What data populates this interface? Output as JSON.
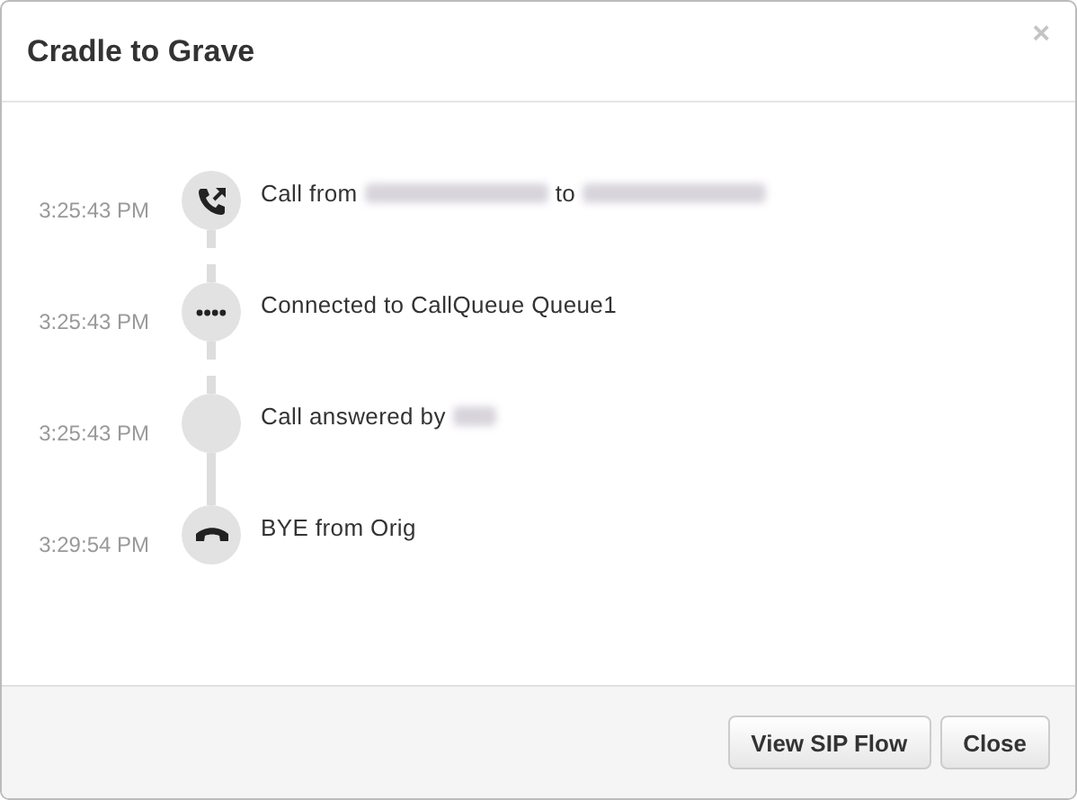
{
  "dialog": {
    "title": "Cradle to Grave",
    "close": "×"
  },
  "events": [
    {
      "time": "3:25:43 PM",
      "kind": "transfer",
      "parts": [
        {
          "kind": "text",
          "text": "Call from"
        },
        {
          "kind": "redacted-long"
        },
        {
          "kind": "text",
          "text": "to"
        },
        {
          "kind": "redacted-long"
        }
      ]
    },
    {
      "time": "3:25:43 PM",
      "kind": "dots",
      "parts": [
        {
          "kind": "text",
          "text": "Connected to CallQueue Queue1"
        }
      ]
    },
    {
      "time": "3:25:43 PM",
      "kind": "blank",
      "parts": [
        {
          "kind": "text",
          "text": "Call answered by"
        },
        {
          "kind": "redacted-short"
        }
      ]
    },
    {
      "time": "3:29:54 PM",
      "kind": "hangup",
      "parts": [
        {
          "kind": "text",
          "text": "BYE from Orig"
        }
      ]
    }
  ],
  "connectors": [
    {
      "kind": "dashed"
    },
    {
      "kind": "dashed"
    },
    {
      "kind": "solid"
    }
  ],
  "buttons": [
    "View SIP Flow",
    "Close"
  ]
}
